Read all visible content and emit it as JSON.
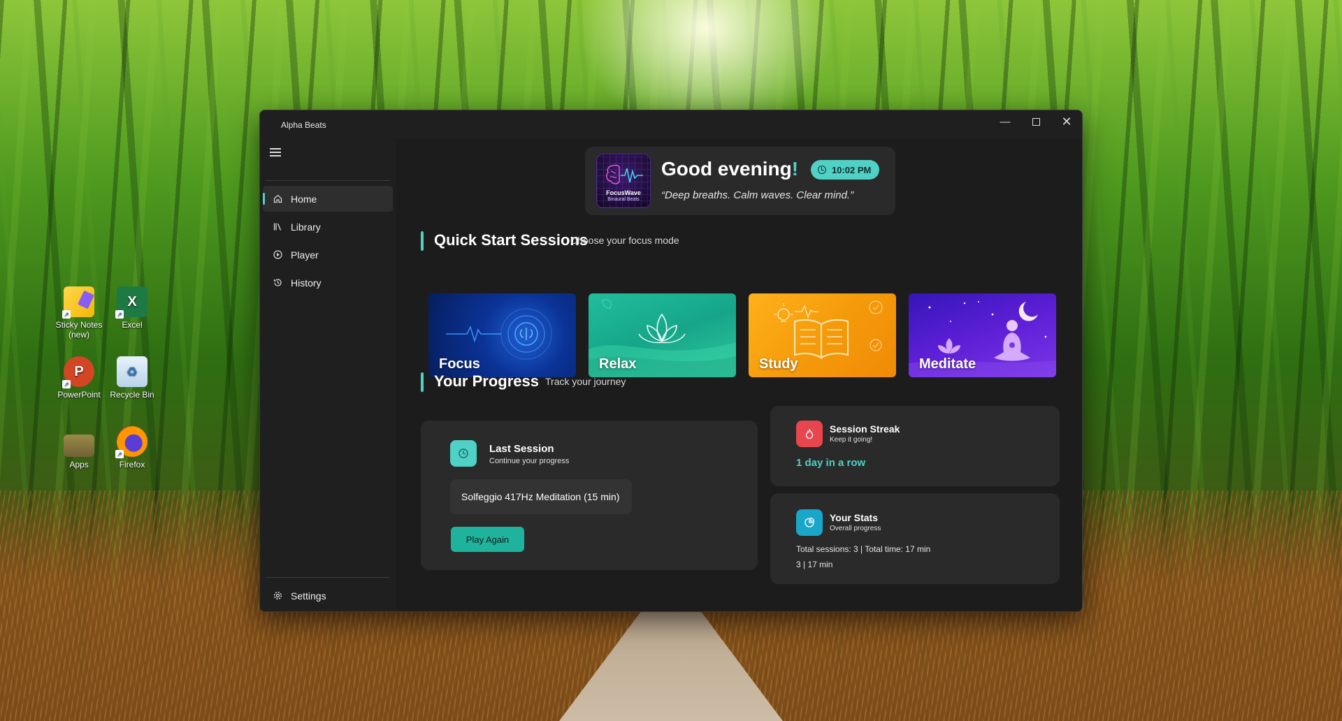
{
  "desktop": {
    "icons": [
      {
        "label": "Sticky Notes (new)",
        "icon": "sticky-notes-icon"
      },
      {
        "label": "Excel",
        "icon": "excel-icon"
      },
      {
        "label": "PowerPoint",
        "icon": "powerpoint-icon"
      },
      {
        "label": "Recycle Bin",
        "icon": "recycle-bin-icon"
      },
      {
        "label": "Apps",
        "icon": "folder-icon"
      },
      {
        "label": "Firefox",
        "icon": "firefox-icon"
      }
    ]
  },
  "window": {
    "title": "Alpha Beats",
    "controls": {
      "minimize": "—",
      "maximize": "",
      "close": "✕"
    }
  },
  "sidebar": {
    "items": [
      {
        "label": "Home",
        "icon": "home-icon",
        "active": true
      },
      {
        "label": "Library",
        "icon": "library-icon"
      },
      {
        "label": "Player",
        "icon": "play-circle-icon"
      },
      {
        "label": "History",
        "icon": "history-icon"
      }
    ],
    "settings": {
      "label": "Settings",
      "icon": "gear-icon"
    }
  },
  "greeting": {
    "title": "Good evening",
    "exclaim": "!",
    "time": "10:02 PM",
    "quote": "“Deep breaths. Calm waves. Clear mind.”",
    "logo_name": "FocusWave",
    "logo_sub": "Binaural Beats"
  },
  "quick_start": {
    "title": "Quick Start Sessions",
    "subtitle": "Choose your focus mode",
    "tiles": [
      {
        "label": "Focus"
      },
      {
        "label": "Relax"
      },
      {
        "label": "Study"
      },
      {
        "label": "Meditate"
      }
    ]
  },
  "progress": {
    "title": "Your Progress",
    "subtitle": "Track your journey",
    "last_session": {
      "title": "Last Session",
      "subtitle": "Continue your progress",
      "session_name": "Solfeggio 417Hz Meditation (15 min)",
      "button": "Play Again"
    },
    "streak": {
      "title": "Session Streak",
      "subtitle": "Keep it going!",
      "value": "1 day in a row"
    },
    "stats": {
      "title": "Your Stats",
      "subtitle": "Overall progress",
      "line1": "Total sessions: 3 | Total time: 17 min",
      "line2": "3 | 17 min"
    }
  },
  "colors": {
    "accent": "#4fd1c5",
    "streak_icon": "#e8464f",
    "stats_icon": "#1aa6c9"
  }
}
